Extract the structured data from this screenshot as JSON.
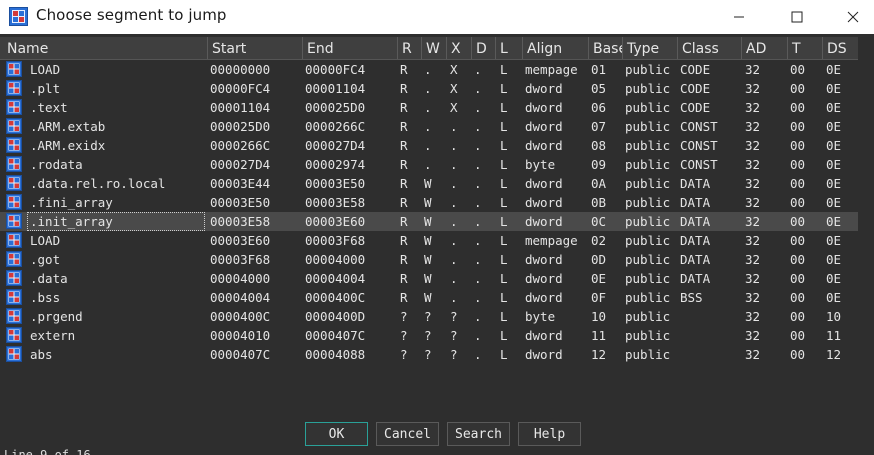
{
  "window": {
    "title": "Choose segment to jump",
    "minimize_label": "—",
    "maximize_label": "☐",
    "close_label": "✕"
  },
  "columns": [
    "Name",
    "Start",
    "End",
    "R",
    "W",
    "X",
    "D",
    "L",
    "Align",
    "Base",
    "Type",
    "Class",
    "AD",
    "T",
    "DS"
  ],
  "rows": [
    {
      "name": "LOAD",
      "start": "00000000",
      "end": "00000FC4",
      "r": "R",
      "w": ".",
      "x": "X",
      "d": ".",
      "l": "L",
      "align": "mempage",
      "base": "01",
      "type": "public",
      "class": "CODE",
      "ad": "32",
      "t": "00",
      "ds": "0E"
    },
    {
      "name": ".plt",
      "start": "00000FC4",
      "end": "00001104",
      "r": "R",
      "w": ".",
      "x": "X",
      "d": ".",
      "l": "L",
      "align": "dword",
      "base": "05",
      "type": "public",
      "class": "CODE",
      "ad": "32",
      "t": "00",
      "ds": "0E"
    },
    {
      "name": ".text",
      "start": "00001104",
      "end": "000025D0",
      "r": "R",
      "w": ".",
      "x": "X",
      "d": ".",
      "l": "L",
      "align": "dword",
      "base": "06",
      "type": "public",
      "class": "CODE",
      "ad": "32",
      "t": "00",
      "ds": "0E"
    },
    {
      "name": ".ARM.extab",
      "start": "000025D0",
      "end": "0000266C",
      "r": "R",
      "w": ".",
      "x": ".",
      "d": ".",
      "l": "L",
      "align": "dword",
      "base": "07",
      "type": "public",
      "class": "CONST",
      "ad": "32",
      "t": "00",
      "ds": "0E"
    },
    {
      "name": ".ARM.exidx",
      "start": "0000266C",
      "end": "000027D4",
      "r": "R",
      "w": ".",
      "x": ".",
      "d": ".",
      "l": "L",
      "align": "dword",
      "base": "08",
      "type": "public",
      "class": "CONST",
      "ad": "32",
      "t": "00",
      "ds": "0E"
    },
    {
      "name": ".rodata",
      "start": "000027D4",
      "end": "00002974",
      "r": "R",
      "w": ".",
      "x": ".",
      "d": ".",
      "l": "L",
      "align": "byte",
      "base": "09",
      "type": "public",
      "class": "CONST",
      "ad": "32",
      "t": "00",
      "ds": "0E"
    },
    {
      "name": ".data.rel.ro.local",
      "start": "00003E44",
      "end": "00003E50",
      "r": "R",
      "w": "W",
      "x": ".",
      "d": ".",
      "l": "L",
      "align": "dword",
      "base": "0A",
      "type": "public",
      "class": "DATA",
      "ad": "32",
      "t": "00",
      "ds": "0E"
    },
    {
      "name": ".fini_array",
      "start": "00003E50",
      "end": "00003E58",
      "r": "R",
      "w": "W",
      "x": ".",
      "d": ".",
      "l": "L",
      "align": "dword",
      "base": "0B",
      "type": "public",
      "class": "DATA",
      "ad": "32",
      "t": "00",
      "ds": "0E"
    },
    {
      "name": ".init_array",
      "start": "00003E58",
      "end": "00003E60",
      "r": "R",
      "w": "W",
      "x": ".",
      "d": ".",
      "l": "L",
      "align": "dword",
      "base": "0C",
      "type": "public",
      "class": "DATA",
      "ad": "32",
      "t": "00",
      "ds": "0E",
      "selected": true
    },
    {
      "name": "LOAD",
      "start": "00003E60",
      "end": "00003F68",
      "r": "R",
      "w": "W",
      "x": ".",
      "d": ".",
      "l": "L",
      "align": "mempage",
      "base": "02",
      "type": "public",
      "class": "DATA",
      "ad": "32",
      "t": "00",
      "ds": "0E"
    },
    {
      "name": ".got",
      "start": "00003F68",
      "end": "00004000",
      "r": "R",
      "w": "W",
      "x": ".",
      "d": ".",
      "l": "L",
      "align": "dword",
      "base": "0D",
      "type": "public",
      "class": "DATA",
      "ad": "32",
      "t": "00",
      "ds": "0E"
    },
    {
      "name": ".data",
      "start": "00004000",
      "end": "00004004",
      "r": "R",
      "w": "W",
      "x": ".",
      "d": ".",
      "l": "L",
      "align": "dword",
      "base": "0E",
      "type": "public",
      "class": "DATA",
      "ad": "32",
      "t": "00",
      "ds": "0E"
    },
    {
      "name": ".bss",
      "start": "00004004",
      "end": "0000400C",
      "r": "R",
      "w": "W",
      "x": ".",
      "d": ".",
      "l": "L",
      "align": "dword",
      "base": "0F",
      "type": "public",
      "class": "BSS",
      "ad": "32",
      "t": "00",
      "ds": "0E"
    },
    {
      "name": ".prgend",
      "start": "0000400C",
      "end": "0000400D",
      "r": "?",
      "w": "?",
      "x": "?",
      "d": ".",
      "l": "L",
      "align": "byte",
      "base": "10",
      "type": "public",
      "class": "",
      "ad": "32",
      "t": "00",
      "ds": "10"
    },
    {
      "name": "extern",
      "start": "00004010",
      "end": "0000407C",
      "r": "?",
      "w": "?",
      "x": "?",
      "d": ".",
      "l": "L",
      "align": "dword",
      "base": "11",
      "type": "public",
      "class": "",
      "ad": "32",
      "t": "00",
      "ds": "11"
    },
    {
      "name": "abs",
      "start": "0000407C",
      "end": "00004088",
      "r": "?",
      "w": "?",
      "x": "?",
      "d": ".",
      "l": "L",
      "align": "dword",
      "base": "12",
      "type": "public",
      "class": "",
      "ad": "32",
      "t": "00",
      "ds": "12"
    }
  ],
  "buttons": {
    "ok": "OK",
    "cancel": "Cancel",
    "search": "Search",
    "help": "Help"
  },
  "status": "Line 9 of 16",
  "colors": {
    "background": "#2e2e2e",
    "header": "#3f3f3f",
    "selected_row": "#4a4a4a",
    "default_button_border": "#2aa198"
  }
}
